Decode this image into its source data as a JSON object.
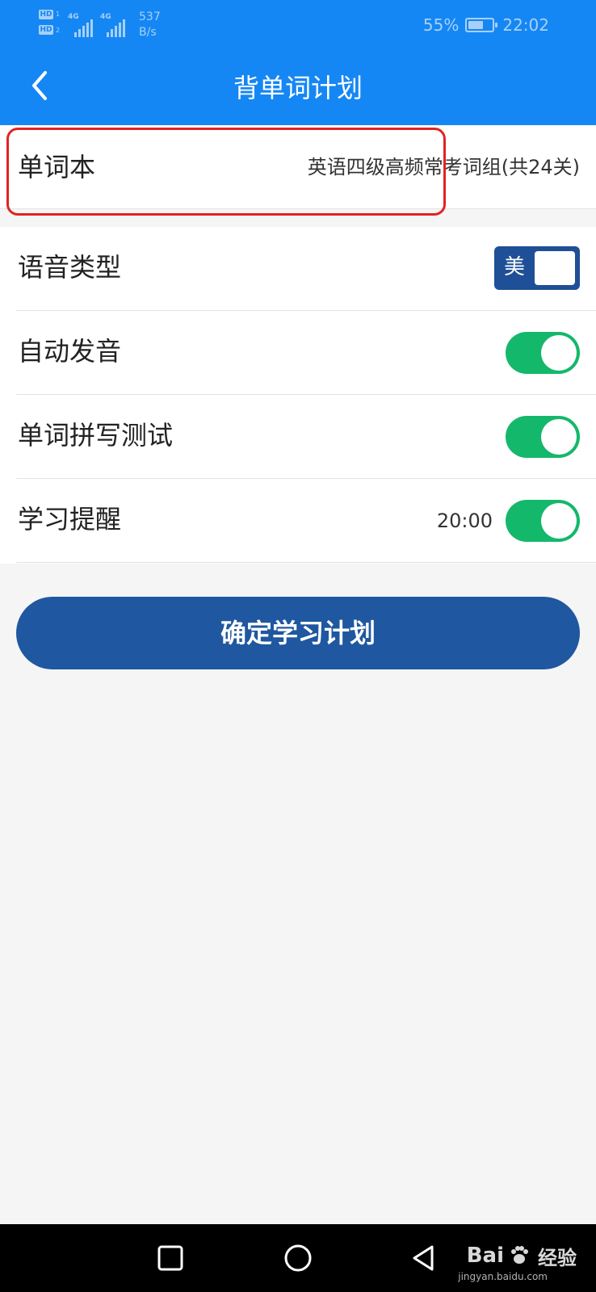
{
  "status_bar": {
    "hd1": "HD",
    "hd1_sub": "1",
    "hd2": "HD",
    "hd2_sub": "2",
    "net1": "4G",
    "net2": "4G",
    "rate_value": "537",
    "rate_unit": "B/s",
    "battery_percent": "55%",
    "battery_level": 0.55,
    "time": "22:02"
  },
  "header": {
    "title": "背单词计划",
    "back_icon": "chevron-left-icon",
    "background_color": "#1587f5"
  },
  "word_book": {
    "label": "单词本",
    "value": "英语四级高频常考词组(共24关)"
  },
  "settings": {
    "voice_type": {
      "label": "语音类型",
      "value": "美",
      "switch_color": "#1f4f96"
    },
    "auto_pronounce": {
      "label": "自动发音",
      "enabled": true
    },
    "spelling_test": {
      "label": "单词拼写测试",
      "enabled": true
    },
    "study_reminder": {
      "label": "学习提醒",
      "time": "20:00",
      "enabled": true
    },
    "toggle_color": "#14b86b"
  },
  "confirm_button": {
    "label": "确定学习计划",
    "color": "#1f57a0"
  },
  "nav_bar": {
    "recent_icon": "square-icon",
    "home_icon": "circle-icon",
    "back_icon": "triangle-back-icon"
  },
  "watermark": {
    "brand_left": "Bai",
    "brand_right": "经验",
    "url": "jingyan.baidu.com"
  }
}
